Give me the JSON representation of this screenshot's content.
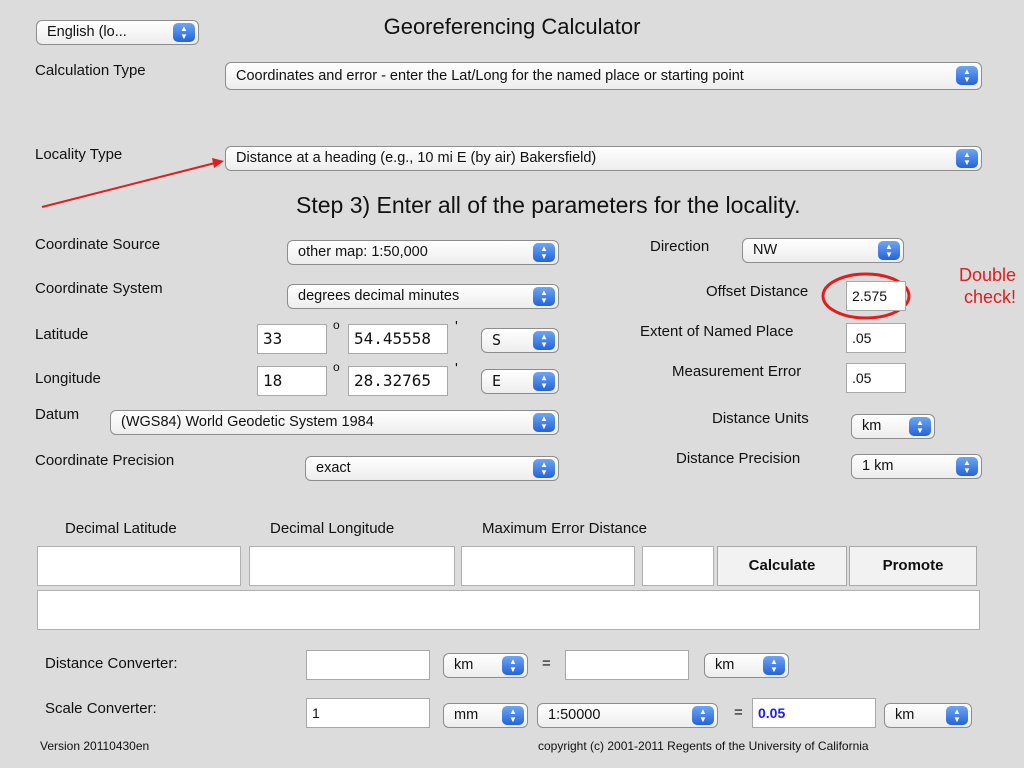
{
  "header": {
    "language": "English (lo...",
    "title": "Georeferencing Calculator"
  },
  "calculation_type": {
    "label": "Calculation Type",
    "value": "Coordinates and error - enter the Lat/Long for the named place or starting point"
  },
  "locality_type": {
    "label": "Locality Type",
    "value": "Distance at a heading (e.g., 10 mi E (by air) Bakersfield)"
  },
  "step_heading": "Step 3) Enter all of the parameters for the locality.",
  "left_form": {
    "coordinate_source": {
      "label": "Coordinate Source",
      "value": "other map: 1:50,000"
    },
    "coordinate_system": {
      "label": "Coordinate System",
      "value": "degrees decimal minutes"
    },
    "latitude": {
      "label": "Latitude",
      "degrees": "33",
      "minutes": "54.45558",
      "hemisphere": "S"
    },
    "longitude": {
      "label": "Longitude",
      "degrees": "18",
      "minutes": "28.32765",
      "hemisphere": "E"
    },
    "degree_symbol": "o",
    "minute_symbol": "'",
    "datum": {
      "label": "Datum",
      "value": "(WGS84) World Geodetic System 1984"
    },
    "coordinate_precision": {
      "label": "Coordinate Precision",
      "value": "exact"
    }
  },
  "right_form": {
    "direction": {
      "label": "Direction",
      "value": "NW"
    },
    "offset_distance": {
      "label": "Offset Distance",
      "value": "2.575"
    },
    "extent_named_place": {
      "label": "Extent of Named Place",
      "value": ".05"
    },
    "measurement_error": {
      "label": "Measurement Error",
      "value": ".05"
    },
    "distance_units": {
      "label": "Distance Units",
      "value": "km"
    },
    "distance_precision": {
      "label": "Distance Precision",
      "value": "1 km"
    }
  },
  "annotation": {
    "line1": "Double",
    "line2": "check!"
  },
  "results": {
    "decimal_latitude_label": "Decimal Latitude",
    "decimal_longitude_label": "Decimal Longitude",
    "max_error_label": "Maximum Error Distance",
    "calculate_button": "Calculate",
    "promote_button": "Promote"
  },
  "distance_converter": {
    "label": "Distance Converter:",
    "from_value": "",
    "from_unit": "km",
    "equals": "=",
    "to_value": "",
    "to_unit": "km"
  },
  "scale_converter": {
    "label": "Scale Converter:",
    "value": "1",
    "unit": "mm",
    "scale": "1:50000",
    "equals": "=",
    "result": "0.05",
    "result_unit": "km"
  },
  "footer": {
    "version": "Version 20110430en",
    "copyright": "copyright (c) 2001-2011 Regents of the University of California"
  },
  "colors": {
    "annotation_red": "#e11d1d",
    "result_blue": "#1a1aff",
    "background": "#dcdcdc"
  }
}
